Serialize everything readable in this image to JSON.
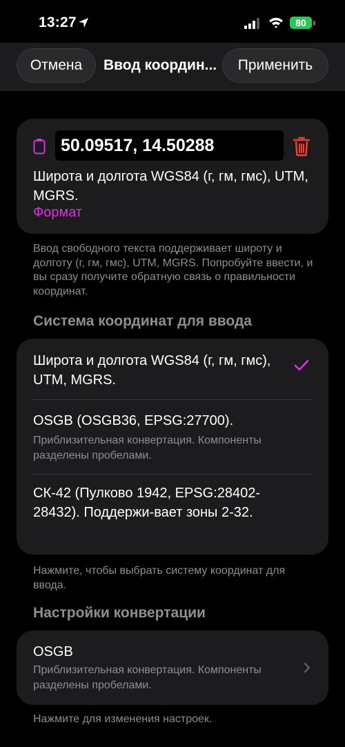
{
  "status_bar": {
    "time": "13:27",
    "battery": "80"
  },
  "nav": {
    "cancel": "Отмена",
    "title": "Ввод координ...",
    "apply": "Применить"
  },
  "input_card": {
    "value": "50.09517, 14.50288",
    "description": "Широта и долгота WGS84 (г, гм, гмс), UTM, MGRS.",
    "format_link": "Формат"
  },
  "input_note": "Ввод свободного текста поддерживает широту и долготу (г, гм, гмс), UTM, MGRS. Попробуйте ввести, и вы сразу получите обратную связь о правильности координат.",
  "system_section": {
    "title": "Система координат для ввода",
    "options": [
      {
        "label": "Широта и долгота WGS84 (г, гм, гмс), UTM, MGRS.",
        "selected": true
      },
      {
        "label": "OSGB (OSGB36, EPSG:27700).",
        "sub": "Приблизительная конвертация. Компоненты разделены пробелами."
      },
      {
        "label": "СК-42 (Пулково 1942, EPSG:28402-28432). Поддержи-вает зоны 2-32."
      }
    ],
    "note": "Нажмите, чтобы выбрать систему координат для ввода."
  },
  "conversion_section": {
    "title": "Настройки конвертации",
    "item_label": "OSGB",
    "item_sub": "Приблизительная конвертация. Компоненты разделены пробелами.",
    "note": "Нажмите для изменения настроек."
  },
  "colors": {
    "accent": "#e02fe6",
    "destructive": "#ff3b30",
    "battery": "#30c559"
  },
  "icons": [
    "location-arrow-icon",
    "signal-icon",
    "wifi-icon",
    "clipboard-icon",
    "trash-icon",
    "checkmark-icon",
    "chevron-right-icon"
  ]
}
